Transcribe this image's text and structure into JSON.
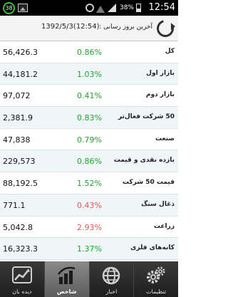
{
  "status_bar": {
    "badge": "38",
    "battery_percent": "38%",
    "time": "12:54"
  },
  "header": {
    "update_label": "آخرین بروز رسانی :",
    "update_value": "1392/5/3(12:54)",
    "refresh_icon": "refresh-icon"
  },
  "rows": [
    {
      "value": "56,426.3",
      "change": "0.86%",
      "trend": "up",
      "name": "کل"
    },
    {
      "value": "44,181.2",
      "change": "1.03%",
      "trend": "up",
      "name": "بازار اول"
    },
    {
      "value": "97,072",
      "change": "0.41%",
      "trend": "up",
      "name": "بازار دوم"
    },
    {
      "value": "2,381.9",
      "change": "0.83%",
      "trend": "up",
      "name": "50 شرکت فعال‌تر"
    },
    {
      "value": "47,838",
      "change": "0.79%",
      "trend": "up",
      "name": "صنعت"
    },
    {
      "value": "229,573",
      "change": "0.86%",
      "trend": "up",
      "name": "بازده نقدی و قیمت"
    },
    {
      "value": "88,192.5",
      "change": "1.52%",
      "trend": "up",
      "name": "قیمت 50 شرکت"
    },
    {
      "value": "771.1",
      "change": "0.43%",
      "trend": "down",
      "name": "ذغال سنگ"
    },
    {
      "value": "5,042.8",
      "change": "2.93%",
      "trend": "down",
      "name": "زراعت"
    },
    {
      "value": "16,323.3",
      "change": "1.37%",
      "trend": "up",
      "name": "کانه‌های فلزی"
    }
  ],
  "colors": {
    "up": "#21a52d",
    "down": "#e15757"
  },
  "bottom_nav": [
    {
      "label": "دیده بان",
      "icon": "chart-icon"
    },
    {
      "label": "شاخص",
      "icon": "bar-chart-icon",
      "active": true
    },
    {
      "label": "اخبار",
      "icon": "globe-icon"
    },
    {
      "label": "تنظیمات",
      "icon": "gear-icon"
    }
  ]
}
